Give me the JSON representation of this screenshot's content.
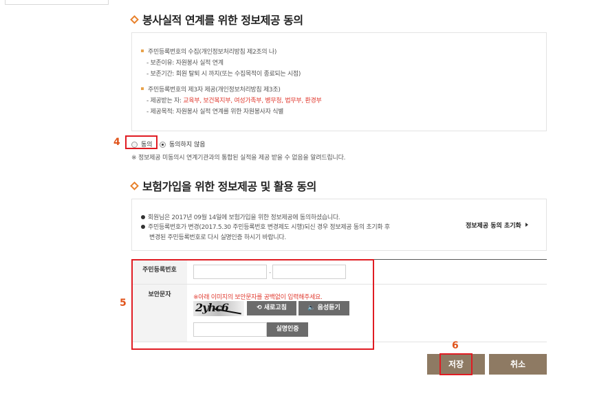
{
  "section1": {
    "title": "봉사실적 연계를 위한 정보제공 동의",
    "items": [
      {
        "head": "주민등록번호의 수집(개인정보처리방침 제2조의 나)"
      },
      {
        "sub": "- 보존이유: 자원봉사 실적 연계"
      },
      {
        "sub": "- 보존기간: 회원 탈퇴 시 까지(또는 수집목적이 종료되는 시점)"
      },
      {
        "head": "주민등록번호의 제3자 제공(개인정보처리방침 제3조)"
      },
      {
        "sub_prefix": "- 제공받는 자: ",
        "sub_red": "교육부, 보건복지부, 여성가족부, 병무청, 법무부, 환경부"
      },
      {
        "sub": "- 제공목적: 자원봉사 실적 연계를 위한 자원봉사자 식별"
      }
    ],
    "agree_label": "동의",
    "disagree_label": "동의하지 않음",
    "selected": "disagree",
    "notice": "※ 정보제공 미동의시 연계기관과의 통합된 실적을 제공 받을 수 없음을 알려드립니다."
  },
  "section2": {
    "title": "보험가입을 위한 정보제공 및 활용 동의",
    "line1": "회원님은 2017년 09월 14일에 보험가입을 위한 정보제공에 동의하셨습니다.",
    "line2": "주민등록번호가 변경(2017.5.30 주민등록번호 변경제도 시행)되신 경우 정보제공 동의 초기화 후",
    "line3": "변경된 주민등록번호로 다시 실명인증 하시기 바랍니다.",
    "reset_link": "정보제공 동의 초기화"
  },
  "form": {
    "rrn_label": "주민등록번호",
    "rrn_front": "",
    "rrn_back": "",
    "rrn_separator": "-",
    "captcha_label": "보안문자",
    "captcha_warning": "※아래 이미지의 보안문자를 공백없이 입력해주세요.",
    "captcha_text": "2yhc6",
    "refresh_label": "새로고침",
    "audio_label": "음성듣기",
    "captcha_input": "",
    "verify_label": "실명인증"
  },
  "annotations": {
    "n4": "4",
    "n5": "5",
    "n6": "6"
  },
  "buttons": {
    "save": "저장",
    "cancel": "취소"
  }
}
